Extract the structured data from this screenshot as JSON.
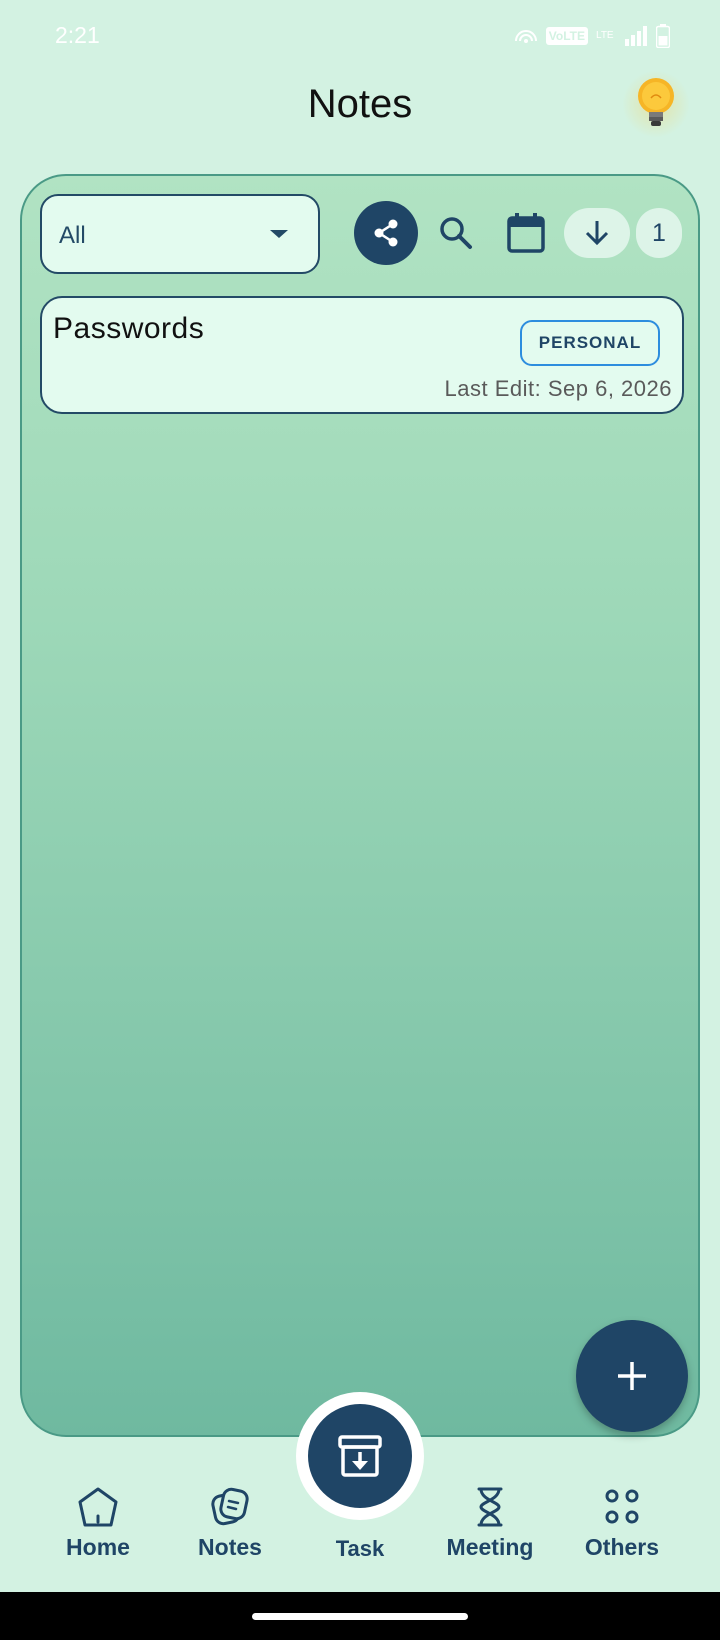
{
  "status_bar": {
    "time": "2:21",
    "volte": "VoLTE",
    "lte": "LTE",
    "icons": [
      "hotspot-icon",
      "volte-icon",
      "lte-icon",
      "signal-icon",
      "battery-icon"
    ]
  },
  "header": {
    "title": "Notes",
    "bulb_icon": "lightbulb-icon"
  },
  "toolbar": {
    "filter_value": "All",
    "count": "1"
  },
  "notes": [
    {
      "title": "Passwords",
      "tag": "PERSONAL",
      "last_edit": "Last Edit: Sep 6, 2026"
    }
  ],
  "bottom_nav": {
    "home": "Home",
    "notes": "Notes",
    "task": "Task",
    "meeting": "Meeting",
    "others": "Others"
  },
  "colors": {
    "background": "#d3f2e2",
    "accent": "#1f4566",
    "tag_border": "#2d8dde",
    "panel_top": "#b1e3c3",
    "panel_bottom": "#6fb9a0"
  }
}
